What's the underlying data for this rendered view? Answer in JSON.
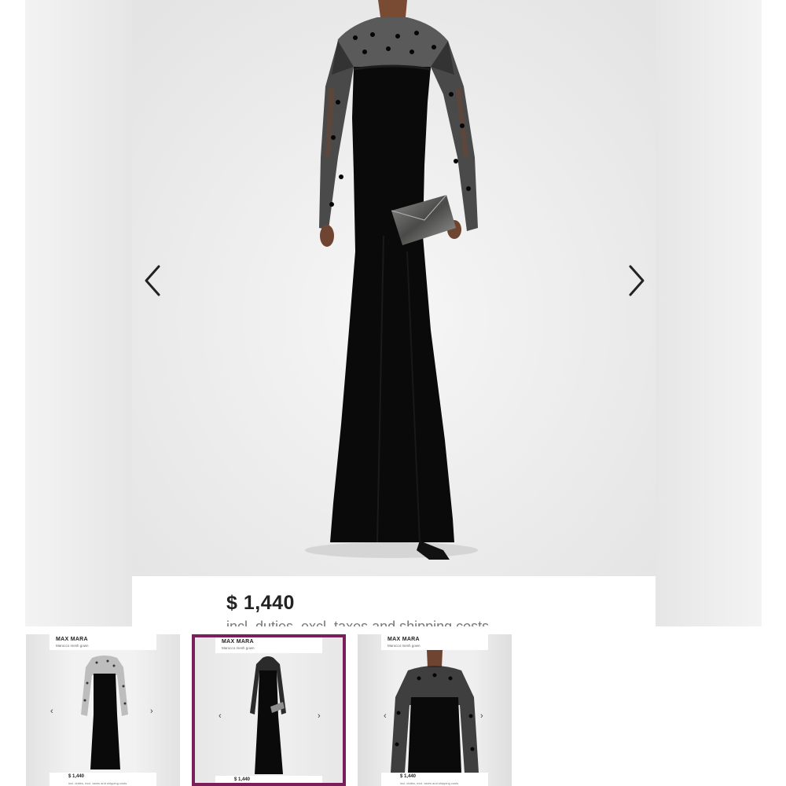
{
  "product": {
    "price": "$ 1,440",
    "duties_note": "incl. duties, excl. taxes and shipping costs"
  },
  "thumbnails": [
    {
      "brand": "MAX MARA",
      "name": "Marocco mesh gown",
      "price": "$ 1,440",
      "note": "incl. duties, excl. taxes and shipping costs",
      "selected": false
    },
    {
      "brand": "MAX MARA",
      "name": "Marocco mesh gown",
      "price": "$ 1,440",
      "note": "",
      "selected": true
    },
    {
      "brand": "MAX MARA",
      "name": "Marocco mesh gown",
      "price": "$ 1,440",
      "note": "incl. duties, excl. taxes and shipping costs",
      "selected": false
    }
  ],
  "icons": {
    "prev": "chevron-left-icon",
    "next": "chevron-right-icon"
  },
  "colors": {
    "selection_border": "#7a1f5a",
    "gown": "#0a0a0a"
  }
}
